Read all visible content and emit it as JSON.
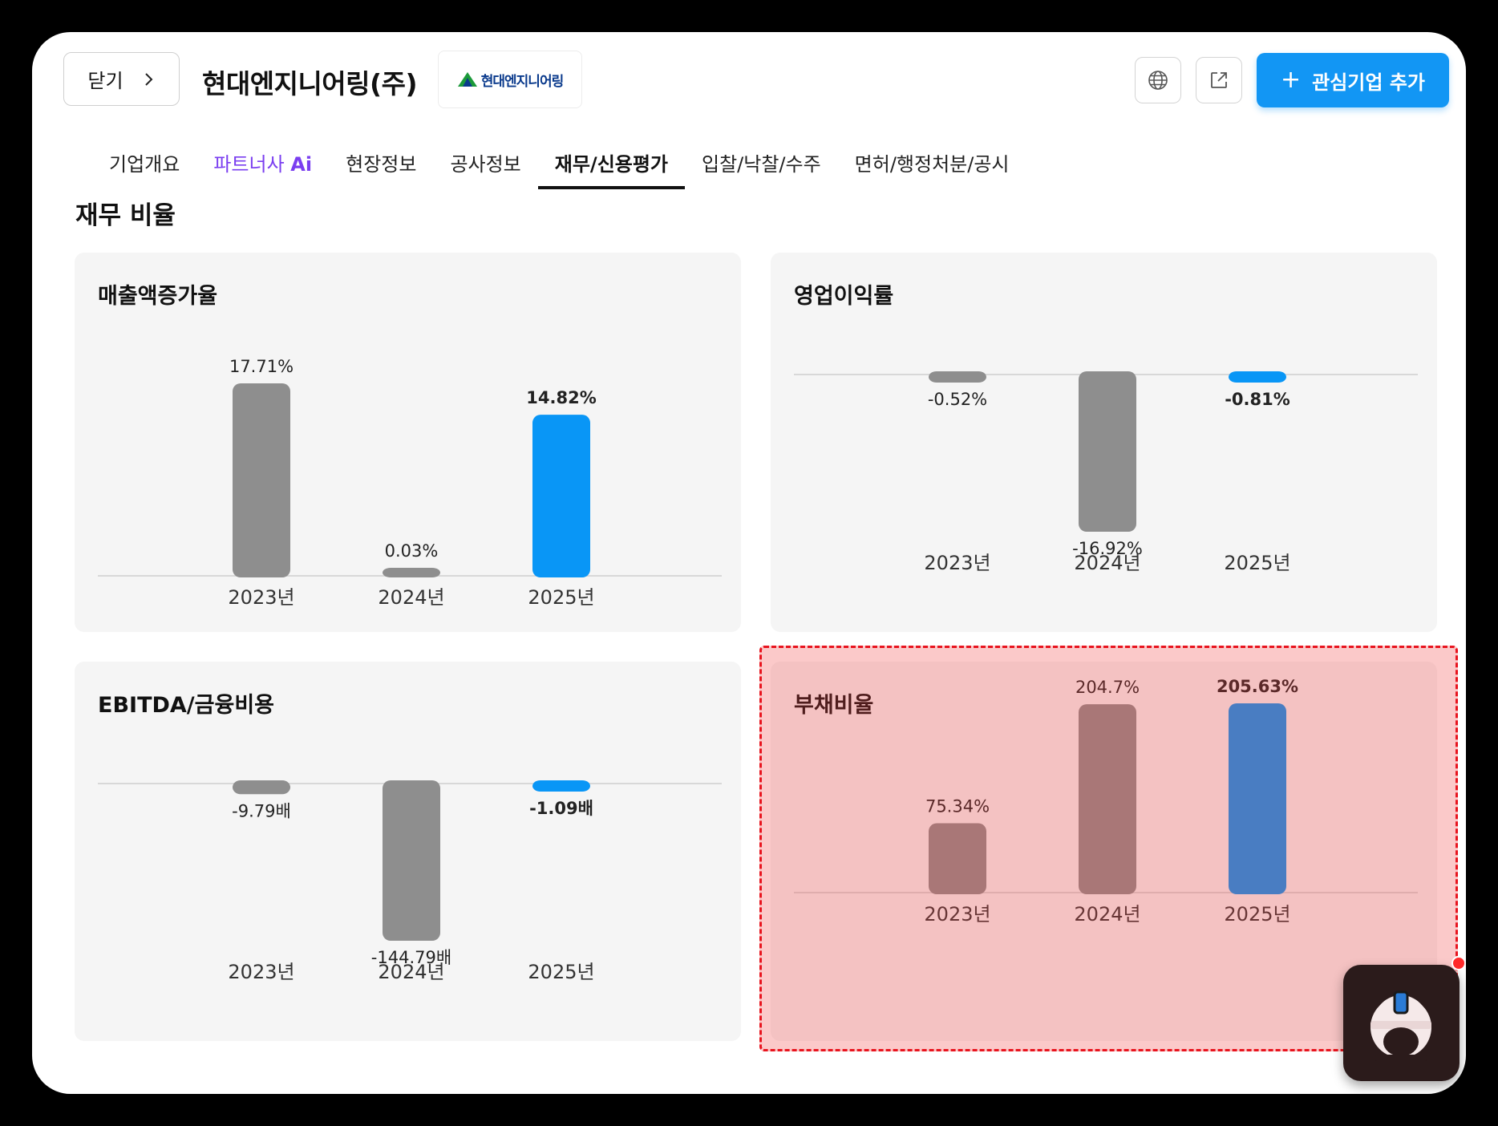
{
  "header": {
    "close_label": "닫기",
    "company_name": "현대엔지니어링(주)",
    "logo_text": "현대엔지니어링",
    "add_button_label": "관심기업 추가"
  },
  "tabs": [
    {
      "label": "기업개요"
    },
    {
      "label": "파트너사",
      "suffix": "Ai"
    },
    {
      "label": "현장정보"
    },
    {
      "label": "공사정보"
    },
    {
      "label": "재무/신용평가"
    },
    {
      "label": "입찰/낙찰/수주"
    },
    {
      "label": "면허/행정처분/공시"
    }
  ],
  "section_title": "재무 비율",
  "colors": {
    "accent": "#1296f4",
    "bar_gray": "#8e8e8e",
    "bar_current": "#0996f6",
    "highlight": "#e8141e"
  },
  "chart_data": [
    {
      "type": "bar",
      "title": "매출액증가율",
      "categories": [
        "2023년",
        "2024년",
        "2025년"
      ],
      "values": [
        17.71,
        0.03,
        14.82
      ],
      "labels": [
        "17.71%",
        "0.03%",
        "14.82%"
      ],
      "highlight_index": 2
    },
    {
      "type": "bar",
      "title": "영업이익률",
      "categories": [
        "2023년",
        "2024년",
        "2025년"
      ],
      "values": [
        -0.52,
        -16.92,
        -0.81
      ],
      "labels": [
        "-0.52%",
        "-16.92%",
        "-0.81%"
      ],
      "highlight_index": 2
    },
    {
      "type": "bar",
      "title": "EBITDA/금융비용",
      "categories": [
        "2023년",
        "2024년",
        "2025년"
      ],
      "values": [
        -9.79,
        -144.79,
        -1.09
      ],
      "labels": [
        "-9.79배",
        "-144.79배",
        "-1.09배"
      ],
      "highlight_index": 2
    },
    {
      "type": "bar",
      "title": "부채비율",
      "categories": [
        "2023년",
        "2024년",
        "2025년"
      ],
      "values": [
        75.34,
        204.7,
        205.63
      ],
      "labels": [
        "75.34%",
        "204.7%",
        "205.63%"
      ],
      "highlight_index": 2
    }
  ]
}
